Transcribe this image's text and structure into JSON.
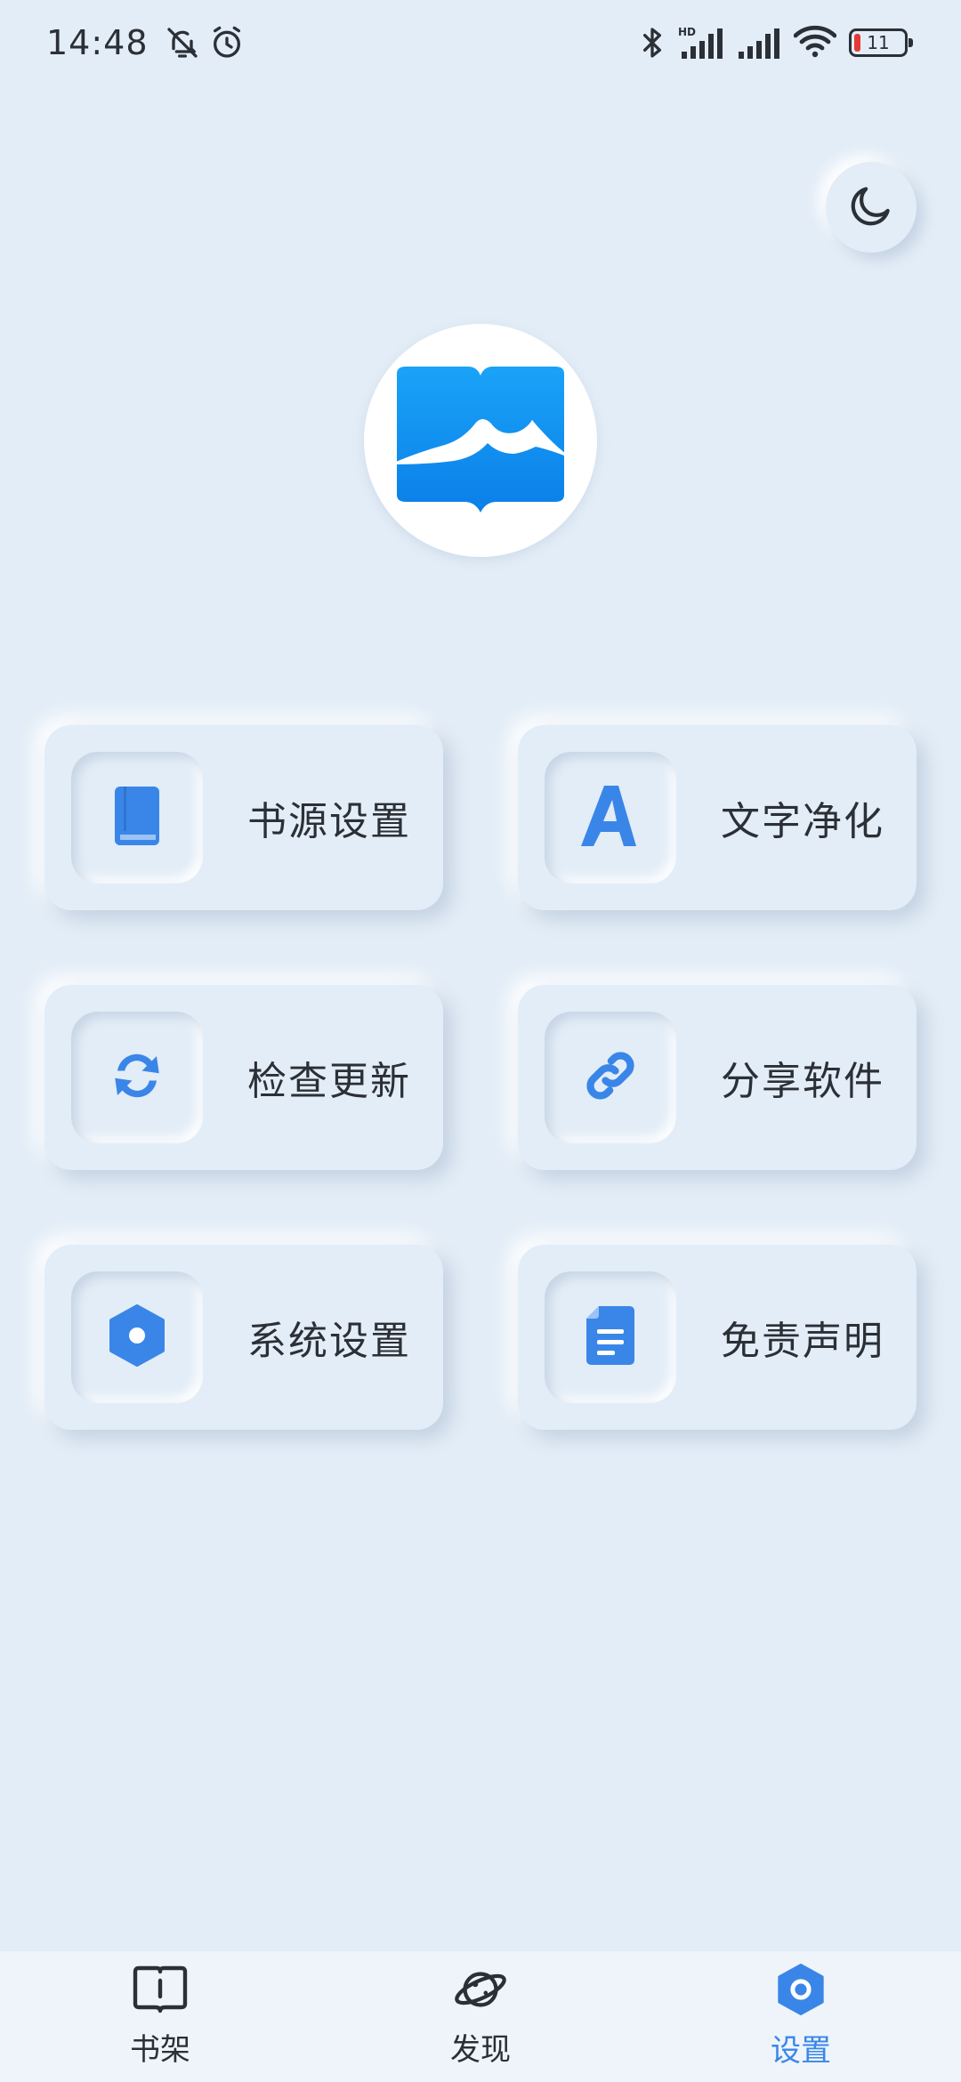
{
  "status_bar": {
    "time": "14:48",
    "battery_level": "11",
    "icons": [
      "mute-bell-icon",
      "alarm-icon",
      "bluetooth-icon",
      "hd-signal-icon",
      "signal-icon",
      "wifi-icon",
      "battery-icon"
    ]
  },
  "header": {
    "theme_toggle_icon": "moon-icon"
  },
  "menu": {
    "items": [
      {
        "label": "书源设置",
        "icon": "book-icon"
      },
      {
        "label": "文字净化",
        "icon": "letter-a-icon"
      },
      {
        "label": "检查更新",
        "icon": "refresh-icon"
      },
      {
        "label": "分享软件",
        "icon": "link-icon"
      },
      {
        "label": "系统设置",
        "icon": "hexagon-settings-icon"
      },
      {
        "label": "免责声明",
        "icon": "document-icon"
      }
    ]
  },
  "bottom_nav": {
    "items": [
      {
        "label": "书架",
        "icon": "open-book-icon"
      },
      {
        "label": "发现",
        "icon": "planet-icon"
      },
      {
        "label": "设置",
        "icon": "hexagon-settings-icon",
        "active": true
      }
    ]
  },
  "colors": {
    "background": "#e3edf7",
    "accent": "#3a86e8",
    "logo_blue": "#1a90f5",
    "text": "#2b2f36"
  }
}
